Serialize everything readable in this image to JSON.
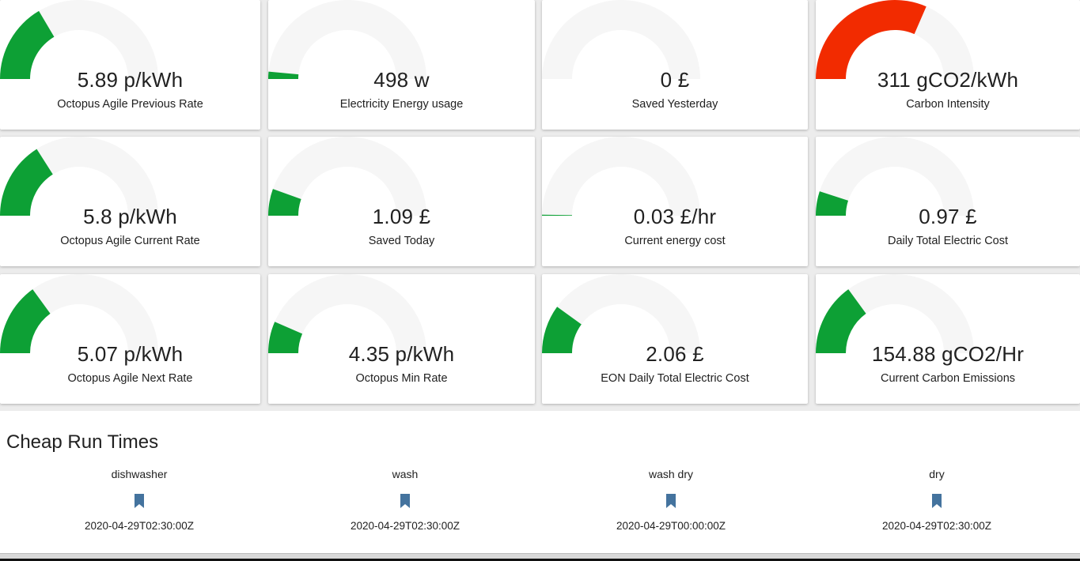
{
  "colors": {
    "good": "#0da035",
    "bad": "#f22b00",
    "track": "#f6f6f6"
  },
  "gauges": [
    {
      "value": "5.89 p/kWh",
      "label": "Octopus Agile Previous Rate",
      "fill": 0.33,
      "color": "good"
    },
    {
      "value": "498 w",
      "label": "Electricity Energy usage",
      "fill": 0.03,
      "color": "good"
    },
    {
      "value": "0 £",
      "label": "Saved Yesterday",
      "fill": 0,
      "color": "good"
    },
    {
      "value": "311 gCO2/kWh",
      "label": "Carbon Intensity",
      "fill": 0.63,
      "color": "bad"
    },
    {
      "value": "5.8 p/kWh",
      "label": "Octopus Agile Current Rate",
      "fill": 0.32,
      "color": "good"
    },
    {
      "value": "1.09 £",
      "label": "Saved Today",
      "fill": 0.11,
      "color": "good"
    },
    {
      "value": "0.03 £/hr",
      "label": "Current energy cost",
      "fill": 0.003,
      "color": "good"
    },
    {
      "value": "0.97 £",
      "label": "Daily Total Electric Cost",
      "fill": 0.1,
      "color": "good"
    },
    {
      "value": "5.07 p/kWh",
      "label": "Octopus Agile Next Rate",
      "fill": 0.3,
      "color": "good"
    },
    {
      "value": "4.35 p/kWh",
      "label": "Octopus Min Rate",
      "fill": 0.13,
      "color": "good"
    },
    {
      "value": "2.06 £",
      "label": "EON Daily Total Electric Cost",
      "fill": 0.2,
      "color": "good"
    },
    {
      "value": "154.88 gCO2/Hr",
      "label": "Current Carbon Emissions",
      "fill": 0.3,
      "color": "good"
    }
  ],
  "cheap_run_times": {
    "title": "Cheap Run Times",
    "icon": "bookmark-icon",
    "icon_color": "#44739e",
    "items": [
      {
        "name": "dishwasher",
        "state": "2020-04-29T02:30:00Z"
      },
      {
        "name": "wash",
        "state": "2020-04-29T02:30:00Z"
      },
      {
        "name": "wash dry",
        "state": "2020-04-29T00:00:00Z"
      },
      {
        "name": "dry",
        "state": "2020-04-29T02:30:00Z"
      }
    ]
  }
}
